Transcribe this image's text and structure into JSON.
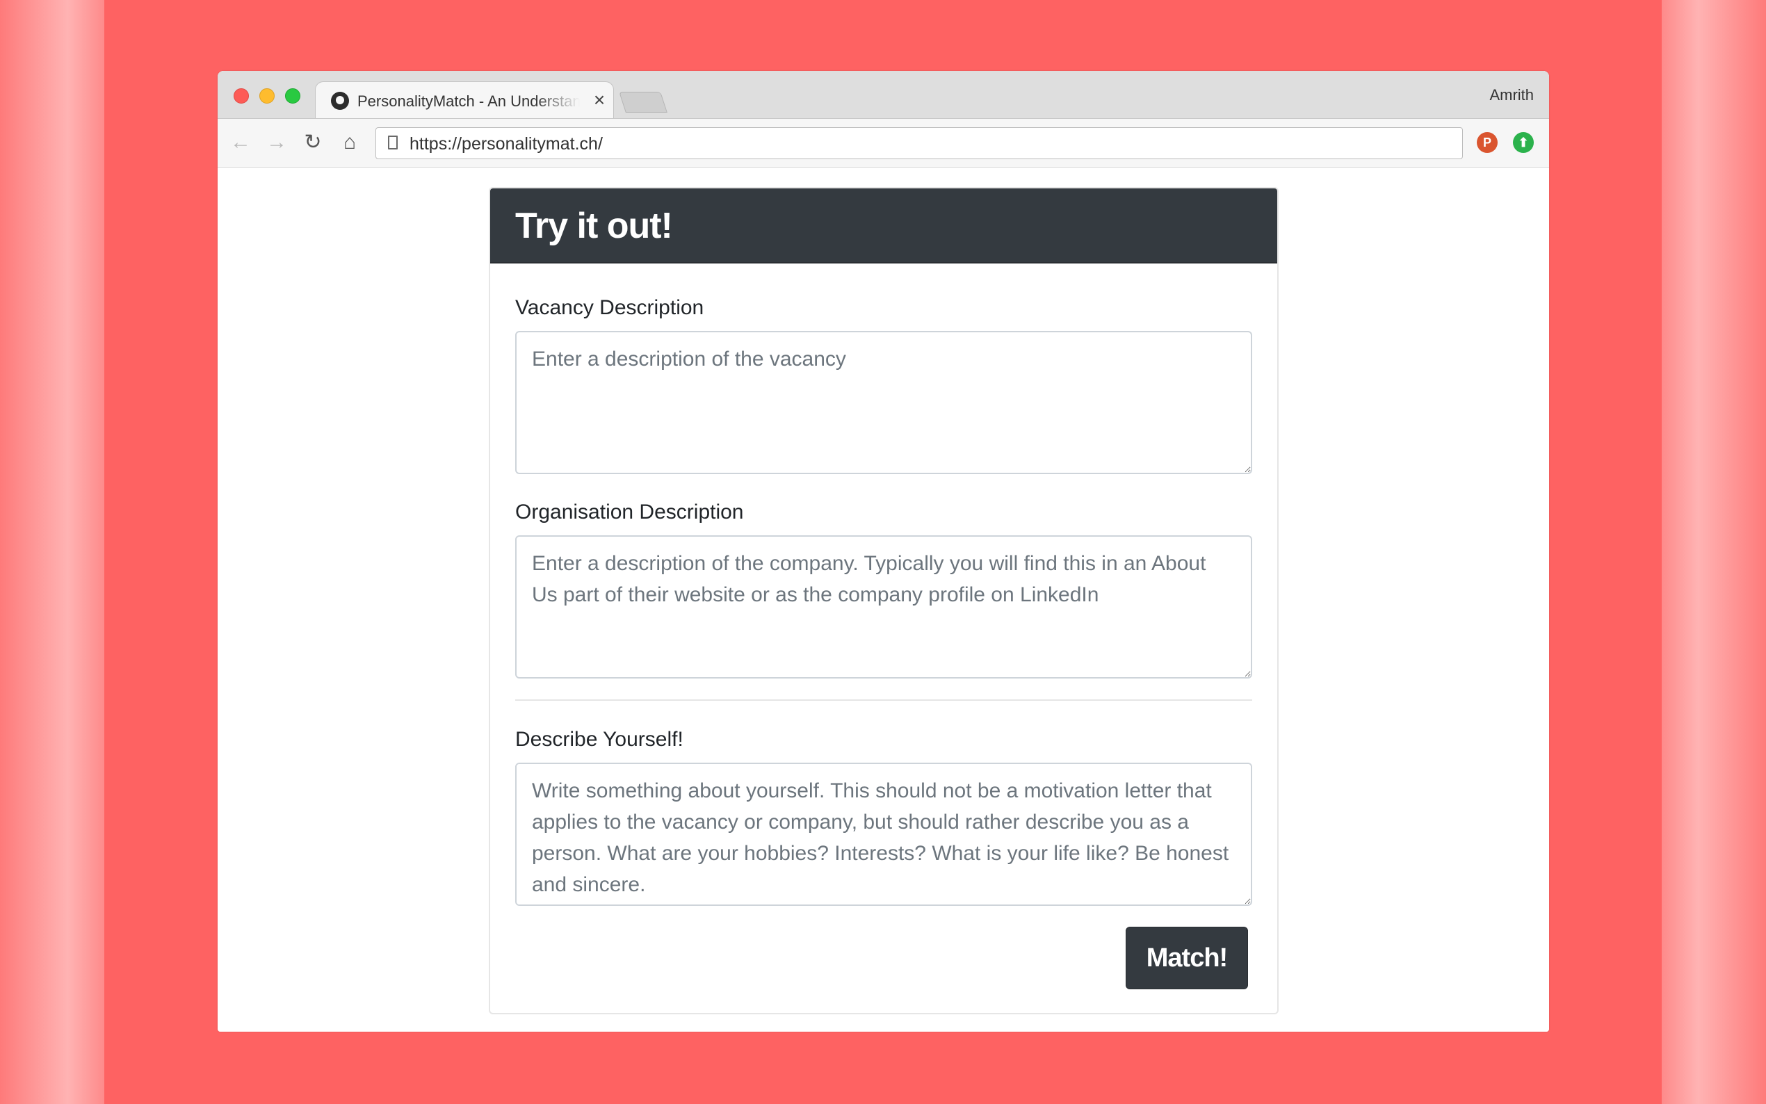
{
  "browser": {
    "tab_title": "PersonalityMatch - An Understanding",
    "tab_close": "×",
    "profile_name": "Amrith",
    "url": "https://personalitymat.ch/",
    "nav": {
      "back_glyph": "←",
      "forward_glyph": "→",
      "reload_glyph": "↻",
      "home_glyph": "⌂"
    },
    "extensions": [
      {
        "icon": "producthunt-icon",
        "label": "P",
        "color": "#da552f"
      },
      {
        "icon": "upload-arrow-icon",
        "label": "⬆",
        "color": "#2bb24c"
      }
    ]
  },
  "form": {
    "title": "Try it out!",
    "vacancy": {
      "label": "Vacancy Description",
      "placeholder": "Enter a description of the vacancy",
      "value": ""
    },
    "organisation": {
      "label": "Organisation Description",
      "placeholder": "Enter a description of the company. Typically you will find this in an About Us part of their website or as the company profile on LinkedIn",
      "value": ""
    },
    "yourself": {
      "label": "Describe Yourself!",
      "placeholder": "Write something about yourself. This should not be a motivation letter that applies to the vacancy or company, but should rather describe you as a person. What are your hobbies? Interests? What is your life like? Be honest and sincere.",
      "value": ""
    },
    "submit_label": "Match!"
  },
  "colors": {
    "background": "#fe6262",
    "card_header": "#343a40",
    "button": "#343a40"
  }
}
